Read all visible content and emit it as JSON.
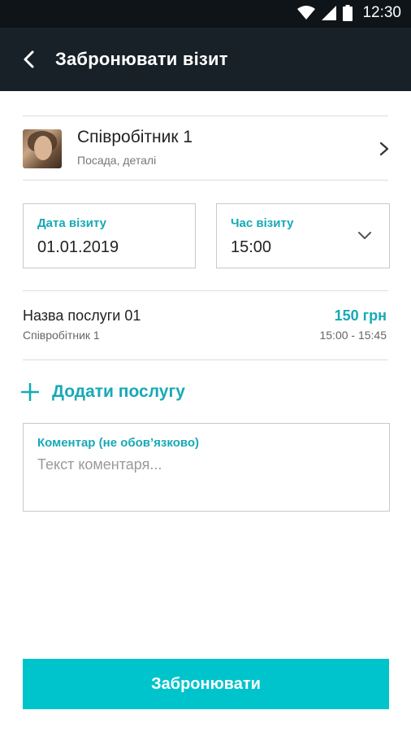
{
  "status_bar": {
    "time": "12:30"
  },
  "app_bar": {
    "title": "Забронювати візит"
  },
  "employee": {
    "name": "Співробітник 1",
    "subtitle": "Посада, деталі"
  },
  "date_field": {
    "label": "Дата візиту",
    "value": "01.01.2019"
  },
  "time_field": {
    "label": "Час візиту",
    "value": "15:00"
  },
  "service": {
    "name": "Назва послуги 01",
    "employee": "Співробітник 1",
    "price": "150 грн",
    "time_range": "15:00 - 15:45"
  },
  "add_service": {
    "label": "Додати послугу"
  },
  "comment": {
    "label": "Коментар (не обов’язково)",
    "placeholder": "Текст коментаря..."
  },
  "book_button": {
    "label": "Забронювати"
  },
  "colors": {
    "accent": "#17a9b6",
    "button": "#00c4cc",
    "app_bar": "#182127",
    "status_bar": "#0e1418"
  }
}
